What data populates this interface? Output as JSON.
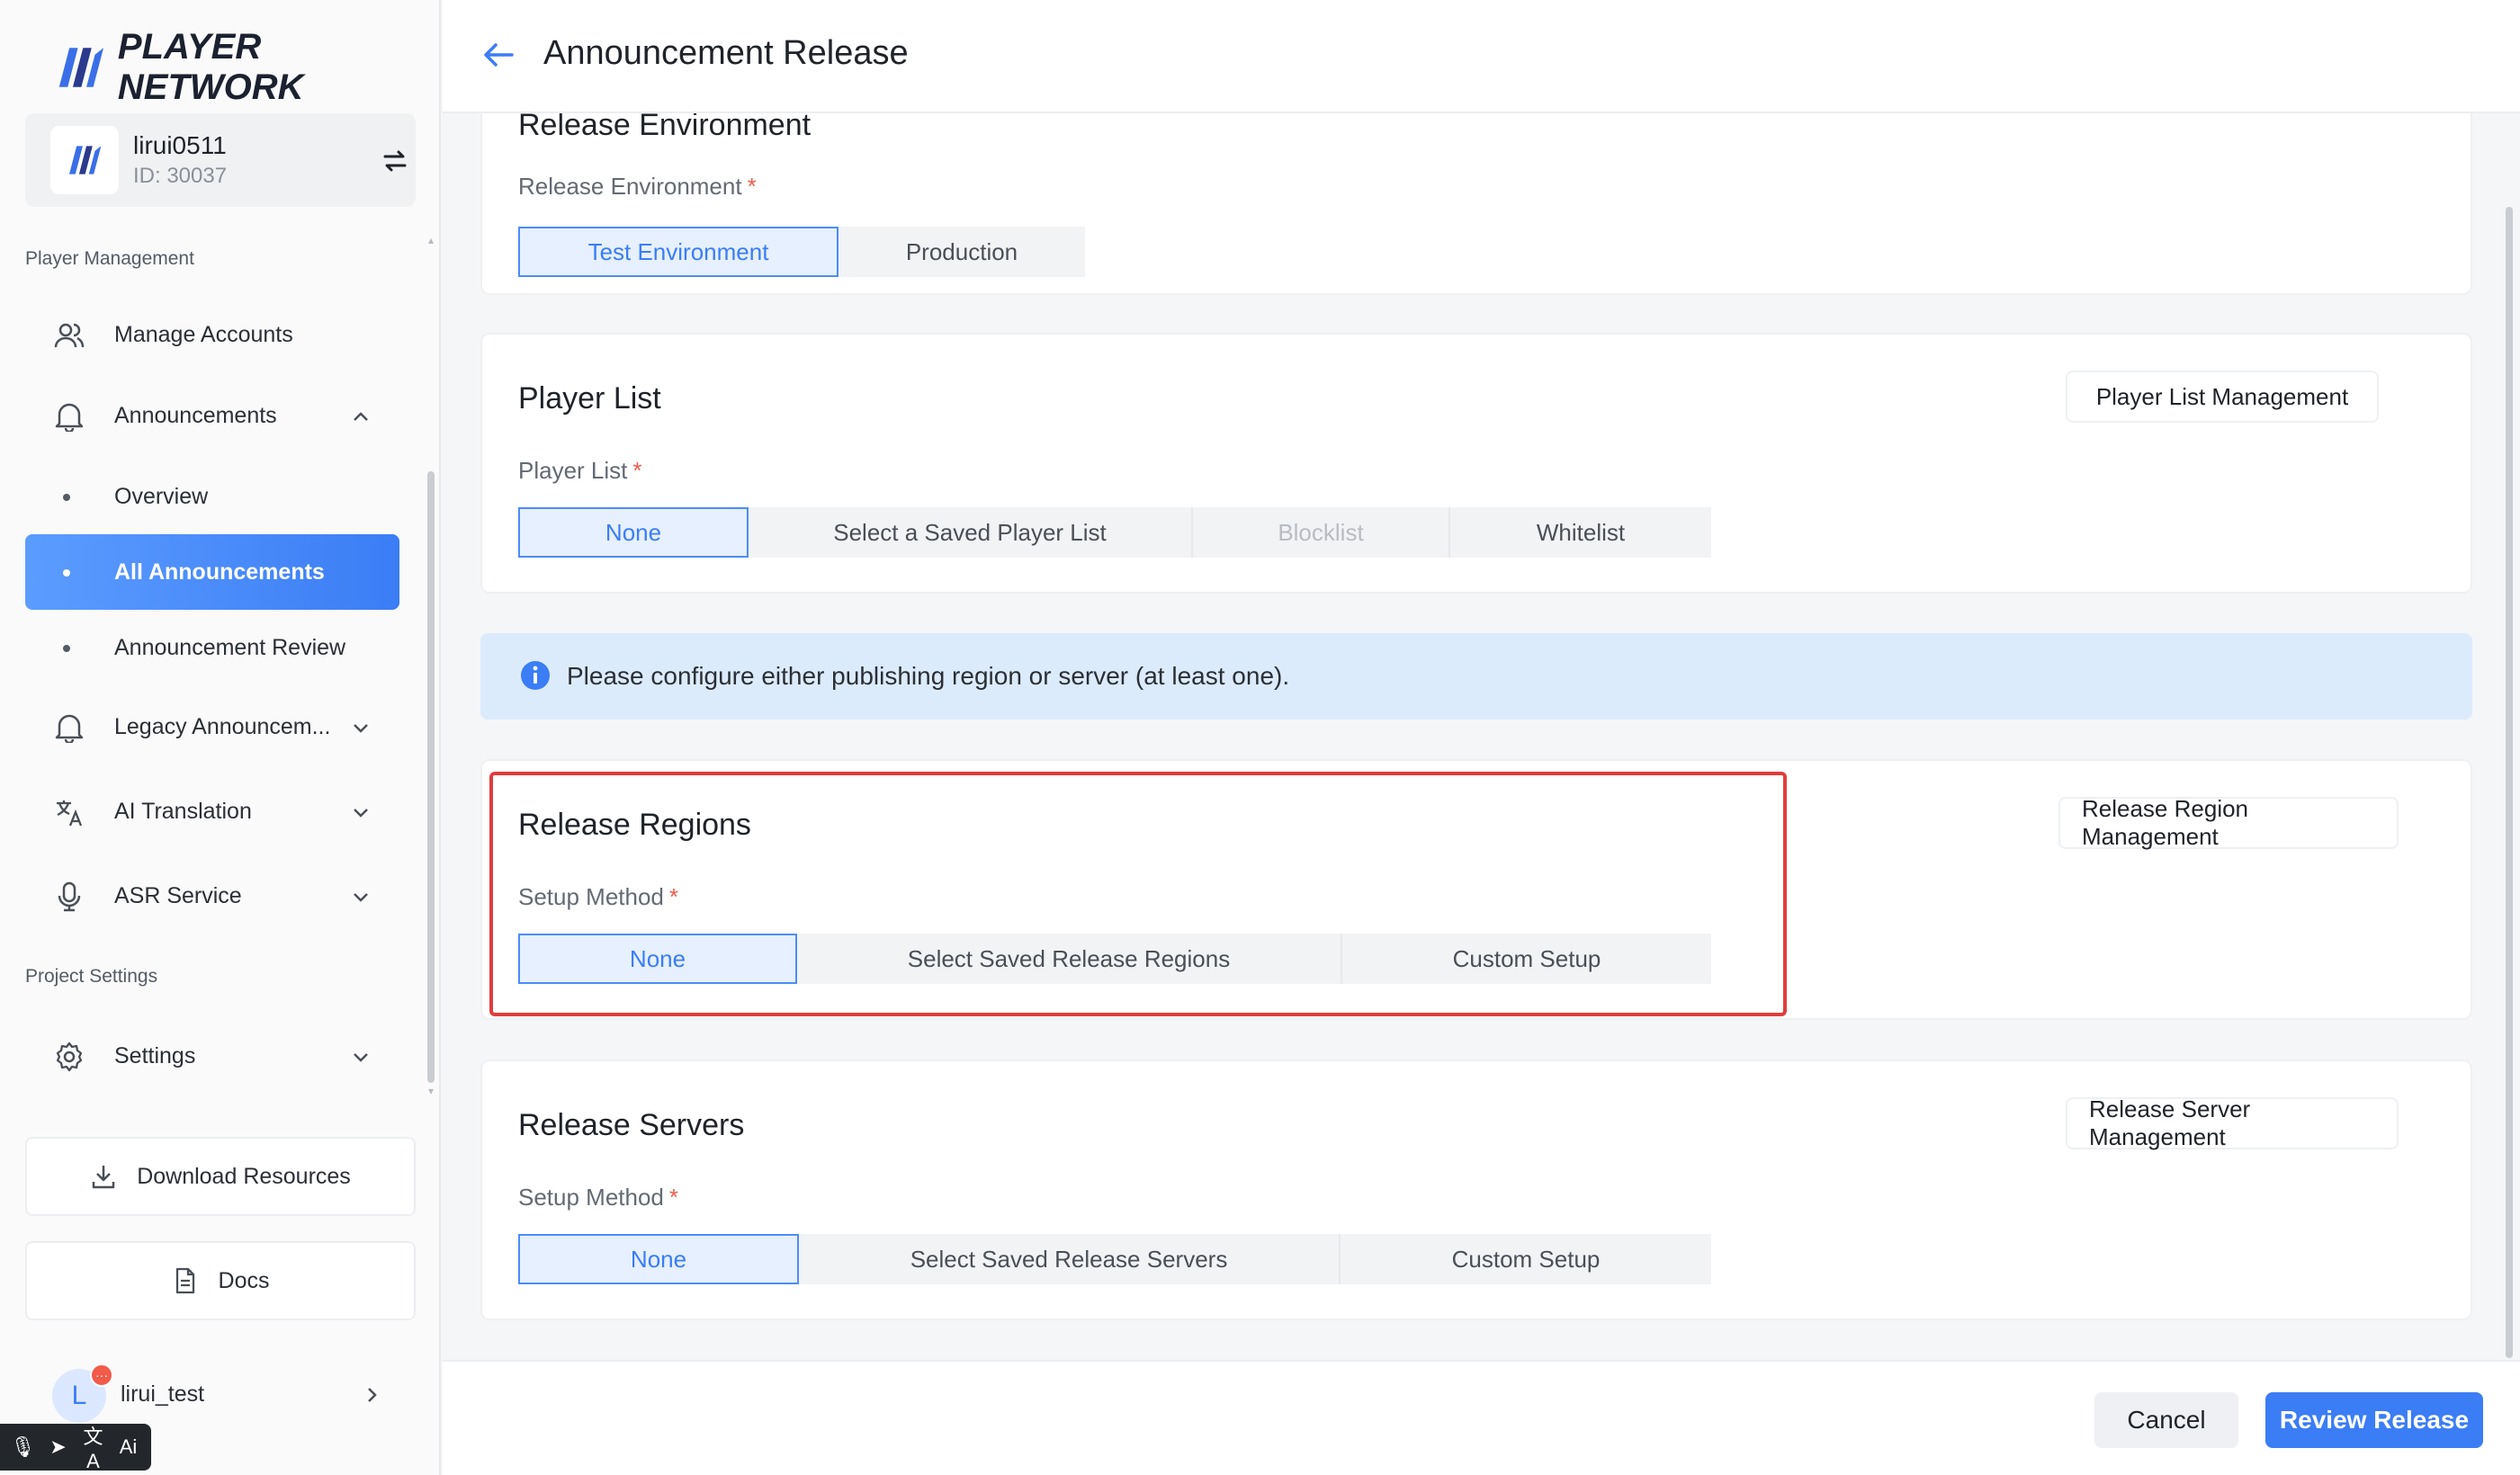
{
  "brand": {
    "name": "PLAYER NETWORK",
    "accent": "#3b7df5"
  },
  "account": {
    "name": "lirui0511",
    "id": "ID: 30037"
  },
  "sidebar": {
    "section_player": "Player Management",
    "manage_accounts": "Manage Accounts",
    "announcements": "Announcements",
    "overview": "Overview",
    "all_announcements": "All Announcements",
    "announcement_review": "Announcement Review",
    "legacy": "Legacy Announcem...",
    "ai_translation": "AI Translation",
    "asr_service": "ASR Service",
    "section_project": "Project Settings",
    "settings": "Settings",
    "download_resources": "Download Resources",
    "docs": "Docs"
  },
  "user": {
    "initial": "L",
    "name": "lirui_test",
    "badge": "···"
  },
  "toolbar": {
    "items": [
      "🎙",
      "➤",
      "文A",
      "Ai"
    ]
  },
  "header": {
    "title": "Announcement Release"
  },
  "env": {
    "section_title_partial": "Release Environment",
    "label": "Release Environment",
    "options": [
      "Test Environment",
      "Production"
    ],
    "selected": "Test Environment"
  },
  "player_list": {
    "title": "Player List",
    "mgmt": "Player List Management",
    "label": "Player List",
    "options": [
      "None",
      "Select a Saved Player List",
      "Blocklist",
      "Whitelist"
    ],
    "selected": "None",
    "disabled": "Blocklist"
  },
  "info": {
    "text": "Please configure either publishing region or server (at least one)."
  },
  "regions": {
    "title": "Release Regions",
    "mgmt": "Release Region Management",
    "label": "Setup Method",
    "options": [
      "None",
      "Select Saved Release Regions",
      "Custom Setup"
    ],
    "selected": "None"
  },
  "servers": {
    "title": "Release Servers",
    "mgmt": "Release Server Management",
    "label": "Setup Method",
    "options": [
      "None",
      "Select Saved Release Servers",
      "Custom Setup"
    ],
    "selected": "None"
  },
  "footer": {
    "cancel": "Cancel",
    "review": "Review Release"
  },
  "required_mark": "*"
}
